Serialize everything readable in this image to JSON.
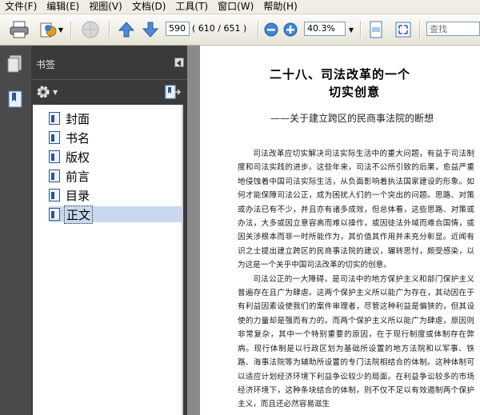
{
  "menubar": {
    "items": [
      "文件(F)",
      "编辑(E)",
      "视图(V)",
      "文档(D)",
      "工具(T)",
      "窗口(W)",
      "帮助(H)"
    ]
  },
  "toolbar": {
    "current_page": "590",
    "page_count": "( 610 / 651 )",
    "zoom": "40.3%",
    "search_placeholder": "查找"
  },
  "bookmarks": {
    "title": "书签",
    "items": [
      {
        "label": "封面",
        "selected": false
      },
      {
        "label": "书名",
        "selected": false
      },
      {
        "label": "版权",
        "selected": false
      },
      {
        "label": "前言",
        "selected": false
      },
      {
        "label": "目录",
        "selected": false
      },
      {
        "label": "正文",
        "selected": true
      }
    ]
  },
  "document": {
    "title_line1": "二十八、司法改革的一个",
    "title_line2": "切实创意",
    "subtitle": "——关于建立跨区的民商事法院的断想",
    "paragraphs": [
      "司法改革应切实解决司法实际生活中的重大问题，有益于司法制度和司法实践的进步。这些年来，司法不公所引致的后果，愈益严重地侵蚀着中国司法实际生活，从负面影响着执法国家建设的形象。如何才能保障司法公正，成为困扰人们的一个突出的问题。思路、对策或办法已有不少，并且亦有诸多成效，但总体看，这些思路、对策或办法，大多或因立意容高而难以操作，或因徒法外域而难合国情，或因关涉根本而非一时所能作为，其价值其作用并未充分彰显。近闻有识之士提出建立跨区的民商事法院的建议，辗转思忖，颇受感染，以为这是一个关乎中国司法改革的切实的创意。",
      "司法公正的一大障碍，是司法中的地方保护主义和部门保护主义普遍存在且广为肆虐。这两个保护主义所以能广为存在，其动因在于有利益因素设使我们的案件审理者，尽管这种利益是偏狭的，但其设使的力量却是强而有力的。而两个保护主义所以能广为肆虐，原因则非常复杂，其中一个特别重要的原因，在于现行制度或体制存在弊病。现行体制是以行政区划为基础所设置的地方法院和以军事、铁路、海事法院等为辅助所设置的专门法院相结合的体制。这种体制可以适应计划经济环境下利益争讼较少的局面。在利益争讼较多的市场经济环境下，这种条块结合的体制，则不仅不足以有效遏制两个保护主义，而且还必然容易滋生"
    ]
  }
}
